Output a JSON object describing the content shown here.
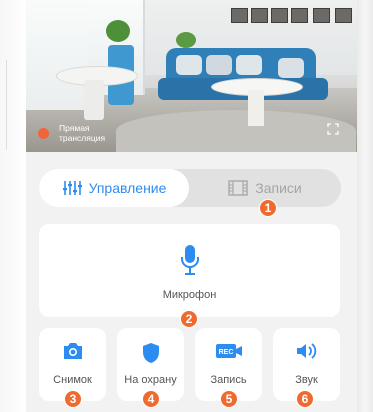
{
  "video": {
    "live_label": "Прямая трансляция",
    "live_color": "#f2643a",
    "fullscreen_icon": "fullscreen-icon"
  },
  "tabs": {
    "control": {
      "label": "Управление",
      "icon": "sliders-icon",
      "active": true
    },
    "records": {
      "label": "Записи",
      "icon": "film-icon",
      "active": false
    }
  },
  "actions": {
    "microphone": {
      "label": "Микрофон",
      "icon": "microphone-icon"
    },
    "snapshot": {
      "label": "Снимок",
      "icon": "camera-icon"
    },
    "arm": {
      "label": "На охрану",
      "icon": "shield-icon"
    },
    "record": {
      "label": "Запись",
      "icon": "rec-camera-icon",
      "icon_text": "REC"
    },
    "sound": {
      "label": "Звук",
      "icon": "speaker-icon"
    }
  },
  "badges": [
    "1",
    "2",
    "3",
    "4",
    "5",
    "6"
  ],
  "colors": {
    "accent": "#2d8cf0",
    "badge": "#ef6a2f",
    "background": "#f2f2f2"
  }
}
